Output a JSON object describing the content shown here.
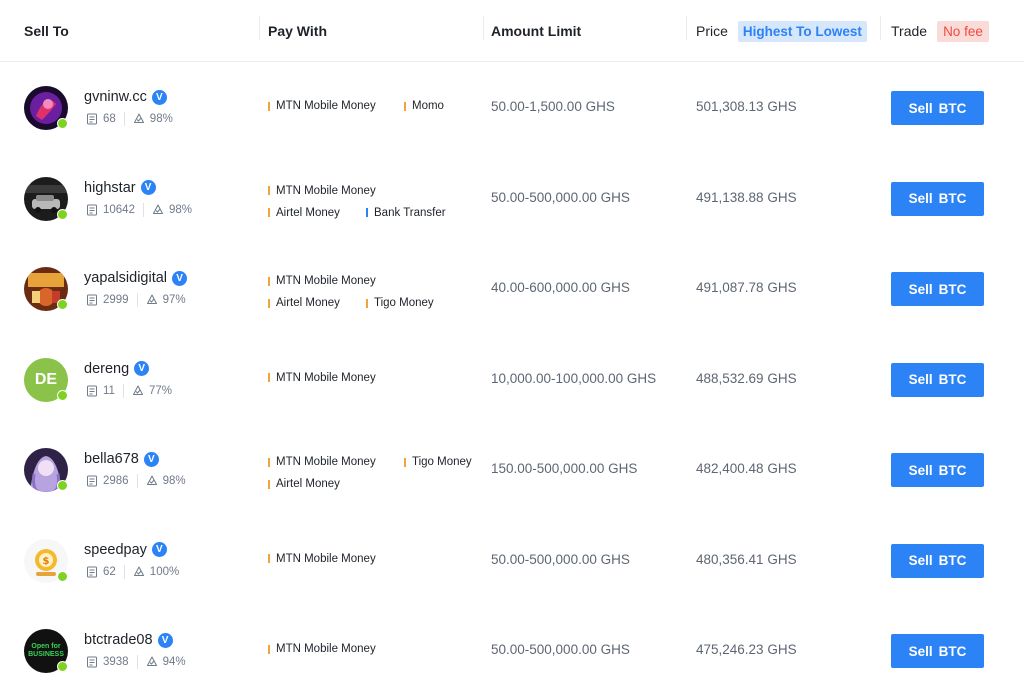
{
  "header": {
    "sell_to": "Sell To",
    "pay_with": "Pay With",
    "amount_limit": "Amount Limit",
    "price": "Price",
    "sort_label": "Highest To Lowest",
    "trade": "Trade",
    "fee_label": "No fee"
  },
  "colors": {
    "accent": "#2b83f6",
    "online": "#7ed321",
    "method_bar_default": "#f0a53a",
    "method_bar_bank": "#2b83f6",
    "fee_red": "#f04a3e"
  },
  "rows": [
    {
      "username": "gvninw.cc",
      "verified": "V",
      "orders": "68",
      "completion": "98%",
      "methods": [
        "MTN Mobile Money",
        "Momo"
      ],
      "amount": "50.00-1,500.00 GHS",
      "price": "501,308.13 GHS",
      "button_action": "Sell",
      "button_asset": "BTC"
    },
    {
      "username": "highstar",
      "verified": "V",
      "orders": "10642",
      "completion": "98%",
      "methods": [
        "MTN Mobile Money",
        "Airtel Money",
        "Bank Transfer"
      ],
      "amount": "50.00-500,000.00 GHS",
      "price": "491,138.88 GHS",
      "button_action": "Sell",
      "button_asset": "BTC"
    },
    {
      "username": "yapalsidigital",
      "verified": "V",
      "orders": "2999",
      "completion": "97%",
      "methods": [
        "MTN Mobile Money",
        "Airtel Money",
        "Tigo Money"
      ],
      "amount": "40.00-600,000.00 GHS",
      "price": "491,087.78 GHS",
      "button_action": "Sell",
      "button_asset": "BTC"
    },
    {
      "username": "dereng",
      "verified": "V",
      "orders": "11",
      "completion": "77%",
      "avatar_initials": "DE",
      "methods": [
        "MTN Mobile Money"
      ],
      "amount": "10,000.00-100,000.00 GHS",
      "price": "488,532.69 GHS",
      "button_action": "Sell",
      "button_asset": "BTC"
    },
    {
      "username": "bella678",
      "verified": "V",
      "orders": "2986",
      "completion": "98%",
      "methods": [
        "MTN Mobile Money",
        "Tigo Money",
        "Airtel Money"
      ],
      "amount": "150.00-500,000.00 GHS",
      "price": "482,400.48 GHS",
      "button_action": "Sell",
      "button_asset": "BTC"
    },
    {
      "username": "speedpay",
      "verified": "V",
      "orders": "62",
      "completion": "100%",
      "methods": [
        "MTN Mobile Money"
      ],
      "amount": "50.00-500,000.00 GHS",
      "price": "480,356.41 GHS",
      "button_action": "Sell",
      "button_asset": "BTC"
    },
    {
      "username": "btctrade08",
      "verified": "V",
      "orders": "3938",
      "completion": "94%",
      "avatar_text": "Open for BUSINESS",
      "methods": [
        "MTN Mobile Money"
      ],
      "amount": "50.00-500,000.00 GHS",
      "price": "475,246.23 GHS",
      "button_action": "Sell",
      "button_asset": "BTC"
    }
  ]
}
